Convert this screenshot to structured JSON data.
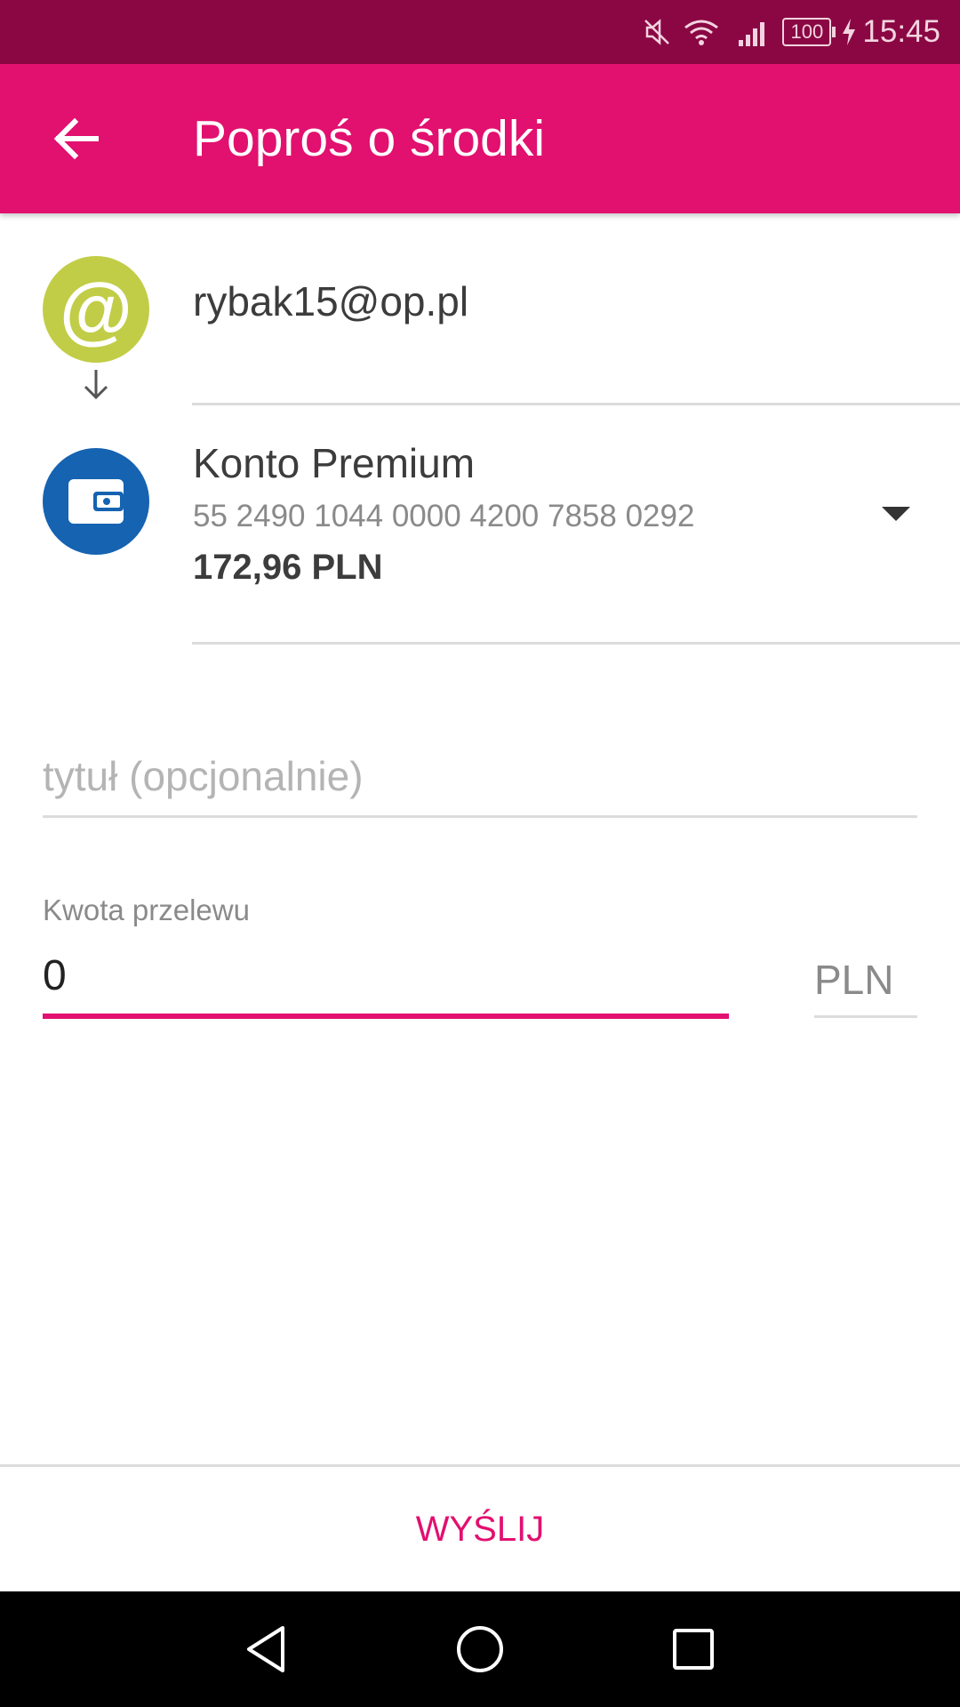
{
  "status_bar": {
    "time": "15:45",
    "battery": "100"
  },
  "header": {
    "title": "Poproś o środki"
  },
  "recipient": {
    "avatar_symbol": "@",
    "email": "rybak15@op.pl"
  },
  "account": {
    "name": "Konto Premium",
    "number": "55 2490 1044 0000 4200 7858 0292",
    "balance": "172,96 PLN"
  },
  "title_field": {
    "placeholder": "tytuł (opcjonalnie)"
  },
  "amount": {
    "label": "Kwota przelewu",
    "value": "0",
    "currency": "PLN"
  },
  "send": {
    "label": "WYŚLIJ"
  },
  "colors": {
    "status_bar": "#8a0743",
    "app_bar": "#e2106f",
    "accent": "#e2106f",
    "email_avatar": "#c1cd46",
    "wallet_avatar": "#1563b1"
  },
  "icons": {
    "back": "arrow-left-icon",
    "flow": "arrow-down-icon",
    "account": "wallet-icon",
    "dropdown": "dropdown-triangle-icon"
  }
}
